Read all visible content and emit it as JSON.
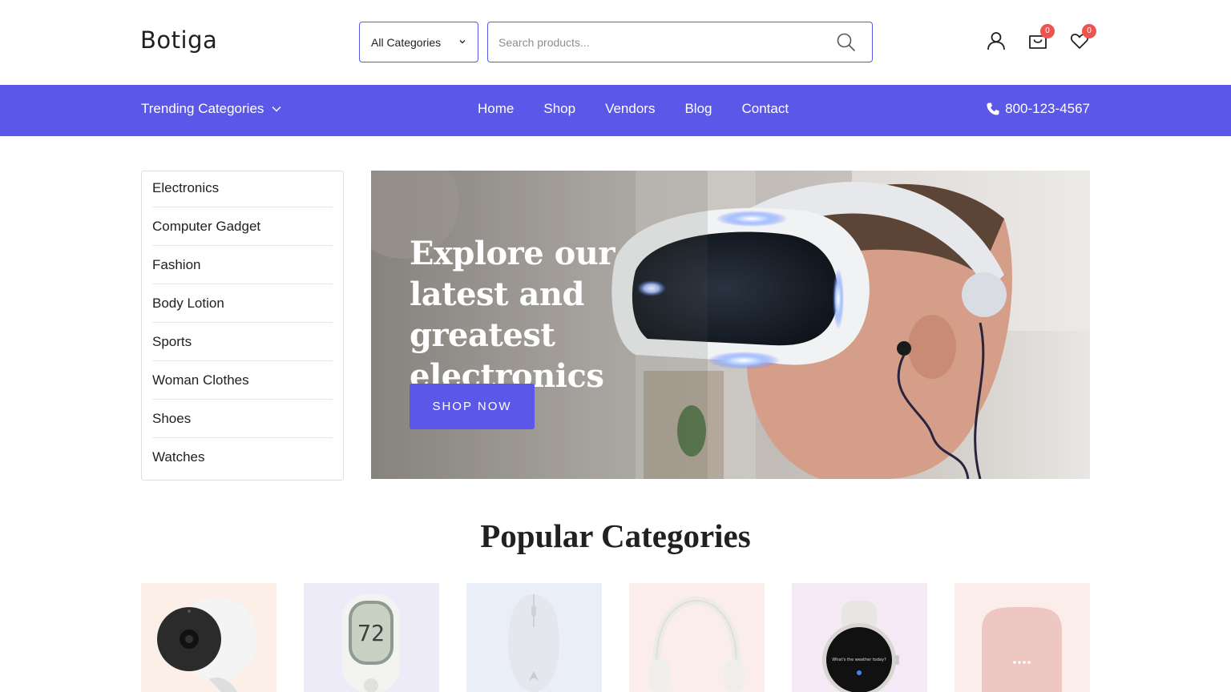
{
  "header": {
    "logo": "Botiga",
    "category_select": "All Categories",
    "search_placeholder": "Search products...",
    "cart_count": "0",
    "wishlist_count": "0",
    "icons": [
      "user-icon",
      "cart-icon",
      "heart-icon",
      "search-icon"
    ]
  },
  "nav": {
    "trending": "Trending Categories",
    "menu": [
      "Home",
      "Shop",
      "Vendors",
      "Blog",
      "Contact"
    ],
    "phone": "800-123-4567"
  },
  "sidebar": {
    "items": [
      "Electronics",
      "Computer Gadget",
      "Fashion",
      "Body Lotion",
      "Sports",
      "Woman Clothes",
      "Shoes",
      "Watches"
    ]
  },
  "hero": {
    "title": "Explore our latest and greatest electronics",
    "button": "SHOP NOW"
  },
  "popular": {
    "title": "Popular Categories",
    "cards": [
      {
        "item": "security-camera",
        "bg": "#fbefe8"
      },
      {
        "item": "thermostat",
        "bg": "#eeebf9"
      },
      {
        "item": "mouse",
        "bg": "#e9eef9"
      },
      {
        "item": "headphones",
        "bg": "#fbeeea"
      },
      {
        "item": "smartwatch",
        "bg": "#f6e9f6"
      },
      {
        "item": "smart-speaker",
        "bg": "#fbeeea"
      }
    ],
    "thermostat_reading": "72",
    "watch_text": "What's the weather today?"
  },
  "colors": {
    "accent": "#5b57e8",
    "badge": "#ef5350"
  }
}
